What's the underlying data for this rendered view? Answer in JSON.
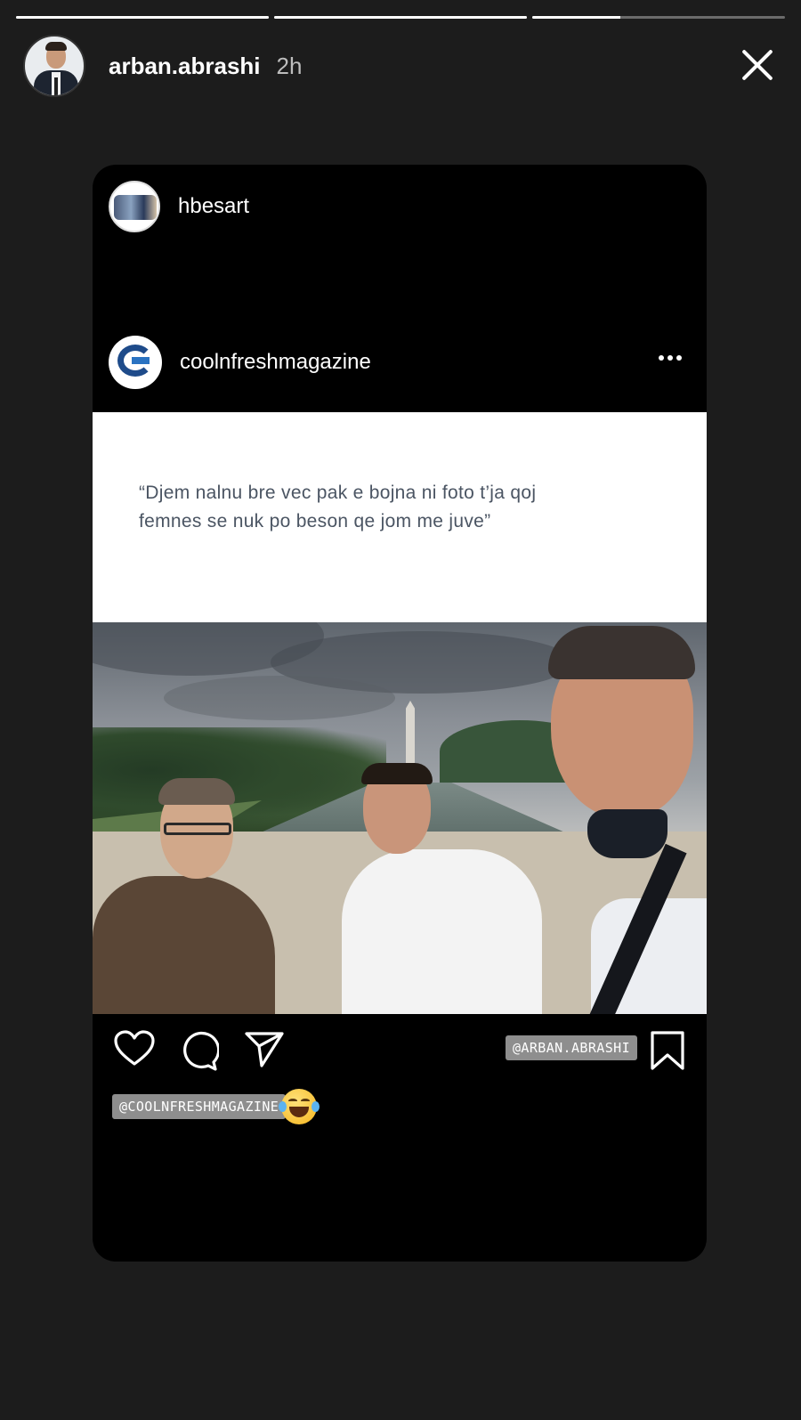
{
  "progress": [
    {
      "segment": 1,
      "filled": 1.0
    },
    {
      "segment": 2,
      "filled": 1.0
    },
    {
      "segment": 3,
      "filled": 0.35
    }
  ],
  "story": {
    "username": "arban.abrashi",
    "time": "2h"
  },
  "shared_post": {
    "sharer": "hbesart",
    "author": "coolnfreshmagazine",
    "quote": "“Djem nalnu bre vec pak e bojna ni foto t’ja qoj femnes se nuk po beson qe jom me juve”"
  },
  "stickers": {
    "mention_arban": "@ARBAN.ABRASHI",
    "mention_cool": "@COOLNFRESHMAGAZINE"
  },
  "icons": [
    "close-icon",
    "heart-icon",
    "comment-icon",
    "share-icon",
    "bookmark-icon",
    "more-icon",
    "laughing-emoji-icon"
  ]
}
